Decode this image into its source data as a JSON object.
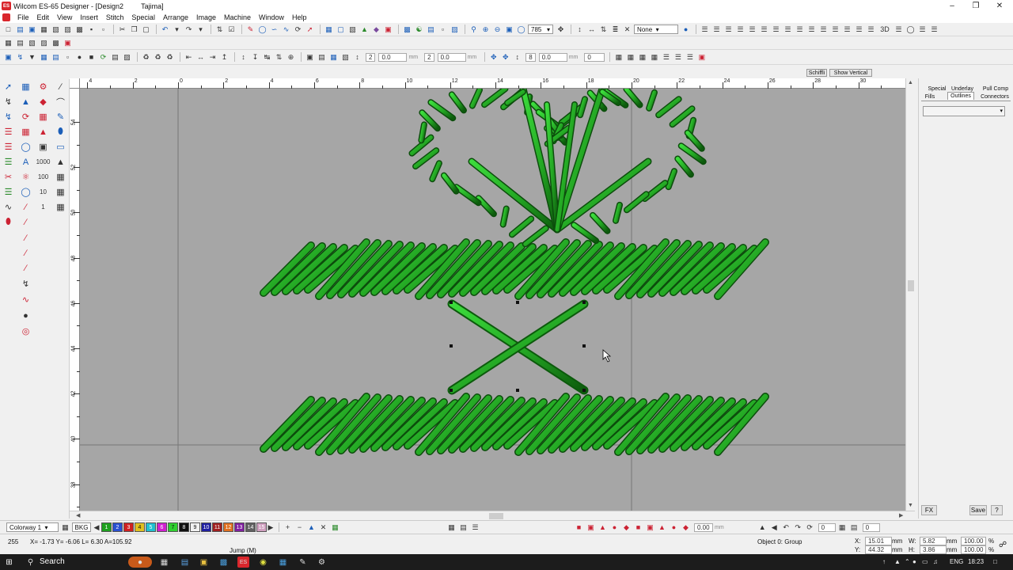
{
  "window": {
    "title": "Wilcom ES-65 Designer - [Design2",
    "machine": "Tajima]",
    "logo_text": "ES"
  },
  "menu": [
    "File",
    "Edit",
    "View",
    "Insert",
    "Stitch",
    "Special",
    "Arrange",
    "Image",
    "Machine",
    "Window",
    "Help"
  ],
  "toolbar": {
    "zoom_value": "785",
    "fill_select": "None",
    "field1": "0.0",
    "field1_unit": "mm",
    "field2_label": "2",
    "field2": "0.0",
    "field2_unit": "mm",
    "field3": "0.0",
    "field3_unit": "mm",
    "field4": "0",
    "angle_a": "2",
    "angle_b": "8"
  },
  "ruler_top": [
    "4",
    "2",
    "0",
    "2",
    "4",
    "6",
    "8",
    "10",
    "12",
    "14",
    "16",
    "18",
    "20",
    "22",
    "24",
    "26",
    "28",
    "30"
  ],
  "ruler_left": [
    "54",
    "52",
    "50",
    "48",
    "46",
    "44",
    "42",
    "40",
    "38"
  ],
  "right_panel": {
    "header_tabs": [
      "Schiffli",
      "Show Vertical"
    ],
    "tabs_row1": [
      "Special",
      "Underlay",
      "Pull Comp"
    ],
    "tabs_row2": [
      "Fills",
      "Outlines",
      "Connectors"
    ],
    "fx_label": "FX",
    "save_label": "Save",
    "help_label": "?"
  },
  "colorbar": {
    "colorway": "Colorway 1",
    "bkg_label": "BKG",
    "swatches": [
      "1",
      "2",
      "3",
      "4",
      "5",
      "6",
      "7",
      "8",
      "9",
      "10",
      "11",
      "12",
      "13",
      "14",
      "15"
    ],
    "swatch_colors": [
      "#1fa01f",
      "#2a50d0",
      "#d02020",
      "#e0c020",
      "#20c0d0",
      "#d020d0",
      "#30d030",
      "#101010",
      "#f0f0f0",
      "#2020a0",
      "#a02020",
      "#e07020",
      "#8020a0",
      "#606060",
      "#d0a0c0"
    ],
    "rotation_value": "0.00",
    "rotation_unit": "mm",
    "angle_value": "0",
    "angle_value2": "0"
  },
  "status": {
    "stitch_count": "255",
    "coords": "X= -1.73 Y= -6.06 L= 6.30 A=105.92",
    "stitch_type": "Jump (M)",
    "object": "Object 0: Group",
    "x_label": "X:",
    "x_value": "15.01",
    "x_unit": "mm",
    "y_label": "Y:",
    "y_value": "44.32",
    "y_unit": "mm",
    "w_label": "W:",
    "w_value": "5.82",
    "w_unit": "mm",
    "h_label": "H:",
    "h_value": "3.86",
    "h_unit": "mm",
    "scale_w": "100.00",
    "scale_h": "100.00",
    "pct": "%"
  },
  "taskbar": {
    "search_label": "Search",
    "lang": "ENG",
    "time": "18:23"
  },
  "colors": {
    "stitch_green": "#2fb82f",
    "canvas_gray": "#a6a6a6"
  }
}
